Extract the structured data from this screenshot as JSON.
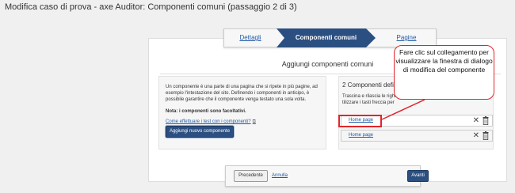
{
  "window": {
    "title": "Modifica caso di prova - axe Auditor: Componenti comuni (passaggio 2 di 3)"
  },
  "stepper": {
    "steps": [
      {
        "label": "Dettagli",
        "state": "done"
      },
      {
        "label": "Componenti comuni",
        "state": "active"
      },
      {
        "label": "Pagine",
        "state": "upcoming"
      }
    ]
  },
  "main": {
    "section_title": "Aggiungi componenti comuni",
    "left": {
      "description": "Un componente è una parte di una pagina che si ripete in più pagine, ad esempio l'intestazione del sito. Definendo i componenti in anticipo, è possibile garantire che il componente venga testato una sola volta.",
      "note": "Nota: i componenti sono facoltativi.",
      "help_link": "Come effettuare i test con i componenti?",
      "help_icon": "external-link-icon",
      "add_button": "Aggiungi nuovo componente"
    },
    "right": {
      "count_label": "2 Componenti defini",
      "instructions": "Trascina e rilascia le righe o tastiera, selezionare il pulsante riordinare.",
      "instructions_suffix": "tilizzare i tasti freccia per",
      "components": [
        {
          "name": "Home page"
        },
        {
          "name": "Home page"
        }
      ]
    }
  },
  "callout": {
    "text": "Fare clic sul collegamento per visualizzare la finestra di dialogo di modifica del componente"
  },
  "footer": {
    "prev_button": "Precedente",
    "cancel_link": "Annulla",
    "next_button": "Avanti"
  },
  "colors": {
    "accent": "#2b4f80",
    "link": "#1f5aa6",
    "highlight": "#e0262c"
  }
}
